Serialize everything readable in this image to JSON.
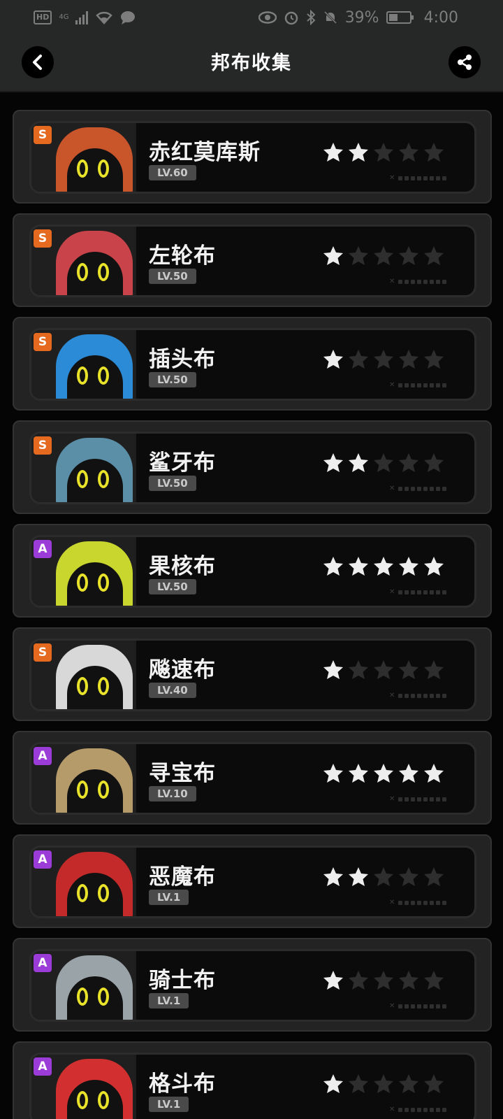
{
  "status_bar": {
    "hd": "HD",
    "network": "4G",
    "battery_percent": "39%",
    "battery_level": 0.39,
    "time": "4:00",
    "icons": [
      "signal-icon",
      "wifi-icon",
      "chat-icon",
      "eye-icon",
      "alarm-icon",
      "bluetooth-icon",
      "mute-bell-icon",
      "battery-icon"
    ]
  },
  "header": {
    "title": "邦布收集",
    "back_icon": "chevron-left-icon",
    "share_icon": "share-icon"
  },
  "bangboo": [
    {
      "name": "赤红莫库斯",
      "level": "LV.60",
      "rank": "S",
      "stars": 2,
      "color": "#c9552a"
    },
    {
      "name": "左轮布",
      "level": "LV.50",
      "rank": "S",
      "stars": 1,
      "color": "#c9444a"
    },
    {
      "name": "插头布",
      "level": "LV.50",
      "rank": "S",
      "stars": 1,
      "color": "#2b8bd6"
    },
    {
      "name": "鲨牙布",
      "level": "LV.50",
      "rank": "S",
      "stars": 2,
      "color": "#5b8fa8"
    },
    {
      "name": "果核布",
      "level": "LV.50",
      "rank": "A",
      "stars": 5,
      "color": "#c9d62e"
    },
    {
      "name": "飚速布",
      "level": "LV.40",
      "rank": "S",
      "stars": 1,
      "color": "#d8d8d8"
    },
    {
      "name": "寻宝布",
      "level": "LV.10",
      "rank": "A",
      "stars": 5,
      "color": "#b59a6a"
    },
    {
      "name": "恶魔布",
      "level": "LV.1",
      "rank": "A",
      "stars": 2,
      "color": "#c42a2a"
    },
    {
      "name": "骑士布",
      "level": "LV.1",
      "rank": "A",
      "stars": 1,
      "color": "#9aa3a8"
    },
    {
      "name": "格斗布",
      "level": "LV.1",
      "rank": "A",
      "stars": 1,
      "color": "#d23030"
    }
  ]
}
